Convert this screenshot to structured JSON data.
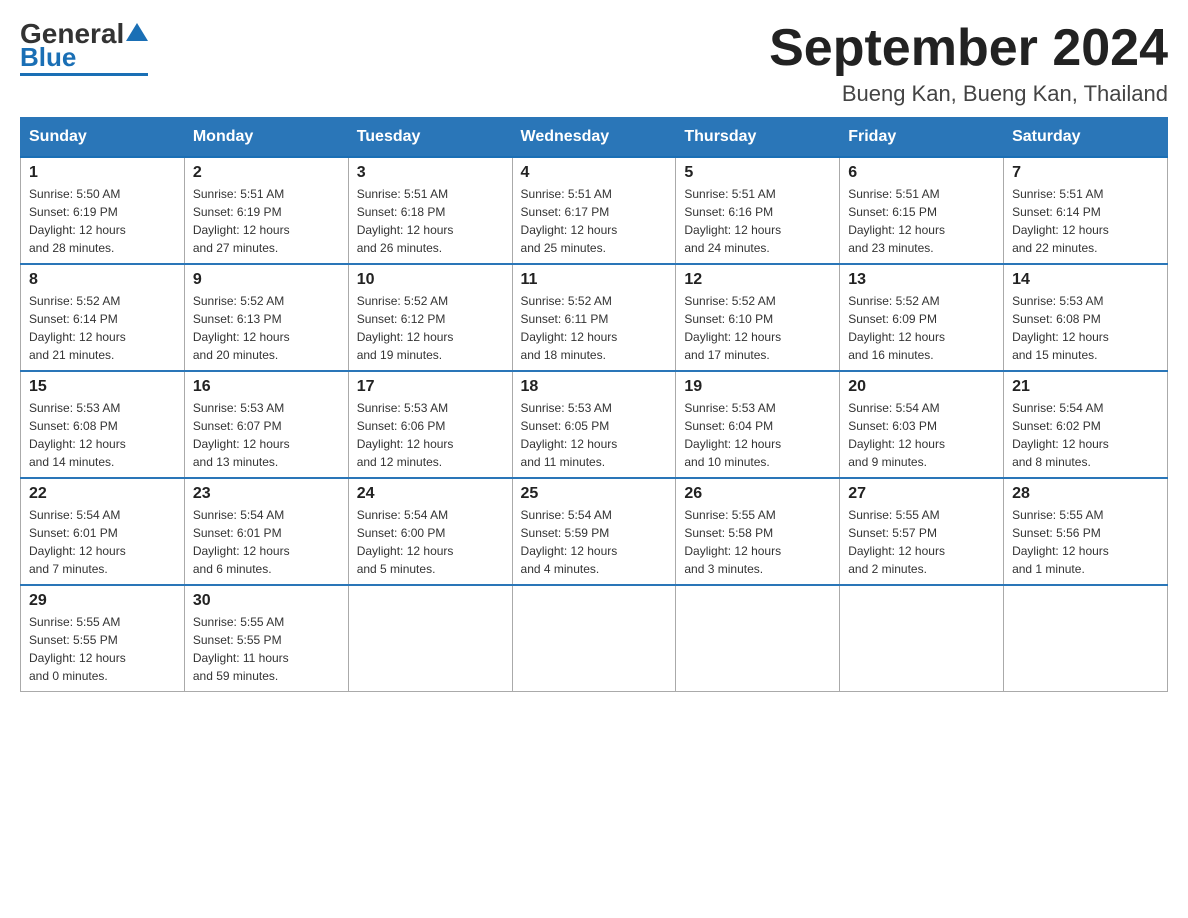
{
  "logo": {
    "text_general": "General",
    "text_blue": "Blue"
  },
  "title": "September 2024",
  "subtitle": "Bueng Kan, Bueng Kan, Thailand",
  "days_of_week": [
    "Sunday",
    "Monday",
    "Tuesday",
    "Wednesday",
    "Thursday",
    "Friday",
    "Saturday"
  ],
  "weeks": [
    [
      {
        "day": "1",
        "sunrise": "5:50 AM",
        "sunset": "6:19 PM",
        "daylight": "12 hours and 28 minutes."
      },
      {
        "day": "2",
        "sunrise": "5:51 AM",
        "sunset": "6:19 PM",
        "daylight": "12 hours and 27 minutes."
      },
      {
        "day": "3",
        "sunrise": "5:51 AM",
        "sunset": "6:18 PM",
        "daylight": "12 hours and 26 minutes."
      },
      {
        "day": "4",
        "sunrise": "5:51 AM",
        "sunset": "6:17 PM",
        "daylight": "12 hours and 25 minutes."
      },
      {
        "day": "5",
        "sunrise": "5:51 AM",
        "sunset": "6:16 PM",
        "daylight": "12 hours and 24 minutes."
      },
      {
        "day": "6",
        "sunrise": "5:51 AM",
        "sunset": "6:15 PM",
        "daylight": "12 hours and 23 minutes."
      },
      {
        "day": "7",
        "sunrise": "5:51 AM",
        "sunset": "6:14 PM",
        "daylight": "12 hours and 22 minutes."
      }
    ],
    [
      {
        "day": "8",
        "sunrise": "5:52 AM",
        "sunset": "6:14 PM",
        "daylight": "12 hours and 21 minutes."
      },
      {
        "day": "9",
        "sunrise": "5:52 AM",
        "sunset": "6:13 PM",
        "daylight": "12 hours and 20 minutes."
      },
      {
        "day": "10",
        "sunrise": "5:52 AM",
        "sunset": "6:12 PM",
        "daylight": "12 hours and 19 minutes."
      },
      {
        "day": "11",
        "sunrise": "5:52 AM",
        "sunset": "6:11 PM",
        "daylight": "12 hours and 18 minutes."
      },
      {
        "day": "12",
        "sunrise": "5:52 AM",
        "sunset": "6:10 PM",
        "daylight": "12 hours and 17 minutes."
      },
      {
        "day": "13",
        "sunrise": "5:52 AM",
        "sunset": "6:09 PM",
        "daylight": "12 hours and 16 minutes."
      },
      {
        "day": "14",
        "sunrise": "5:53 AM",
        "sunset": "6:08 PM",
        "daylight": "12 hours and 15 minutes."
      }
    ],
    [
      {
        "day": "15",
        "sunrise": "5:53 AM",
        "sunset": "6:08 PM",
        "daylight": "12 hours and 14 minutes."
      },
      {
        "day": "16",
        "sunrise": "5:53 AM",
        "sunset": "6:07 PM",
        "daylight": "12 hours and 13 minutes."
      },
      {
        "day": "17",
        "sunrise": "5:53 AM",
        "sunset": "6:06 PM",
        "daylight": "12 hours and 12 minutes."
      },
      {
        "day": "18",
        "sunrise": "5:53 AM",
        "sunset": "6:05 PM",
        "daylight": "12 hours and 11 minutes."
      },
      {
        "day": "19",
        "sunrise": "5:53 AM",
        "sunset": "6:04 PM",
        "daylight": "12 hours and 10 minutes."
      },
      {
        "day": "20",
        "sunrise": "5:54 AM",
        "sunset": "6:03 PM",
        "daylight": "12 hours and 9 minutes."
      },
      {
        "day": "21",
        "sunrise": "5:54 AM",
        "sunset": "6:02 PM",
        "daylight": "12 hours and 8 minutes."
      }
    ],
    [
      {
        "day": "22",
        "sunrise": "5:54 AM",
        "sunset": "6:01 PM",
        "daylight": "12 hours and 7 minutes."
      },
      {
        "day": "23",
        "sunrise": "5:54 AM",
        "sunset": "6:01 PM",
        "daylight": "12 hours and 6 minutes."
      },
      {
        "day": "24",
        "sunrise": "5:54 AM",
        "sunset": "6:00 PM",
        "daylight": "12 hours and 5 minutes."
      },
      {
        "day": "25",
        "sunrise": "5:54 AM",
        "sunset": "5:59 PM",
        "daylight": "12 hours and 4 minutes."
      },
      {
        "day": "26",
        "sunrise": "5:55 AM",
        "sunset": "5:58 PM",
        "daylight": "12 hours and 3 minutes."
      },
      {
        "day": "27",
        "sunrise": "5:55 AM",
        "sunset": "5:57 PM",
        "daylight": "12 hours and 2 minutes."
      },
      {
        "day": "28",
        "sunrise": "5:55 AM",
        "sunset": "5:56 PM",
        "daylight": "12 hours and 1 minute."
      }
    ],
    [
      {
        "day": "29",
        "sunrise": "5:55 AM",
        "sunset": "5:55 PM",
        "daylight": "12 hours and 0 minutes."
      },
      {
        "day": "30",
        "sunrise": "5:55 AM",
        "sunset": "5:55 PM",
        "daylight": "11 hours and 59 minutes."
      },
      null,
      null,
      null,
      null,
      null
    ]
  ],
  "labels": {
    "sunrise": "Sunrise:",
    "sunset": "Sunset:",
    "daylight": "Daylight:"
  }
}
